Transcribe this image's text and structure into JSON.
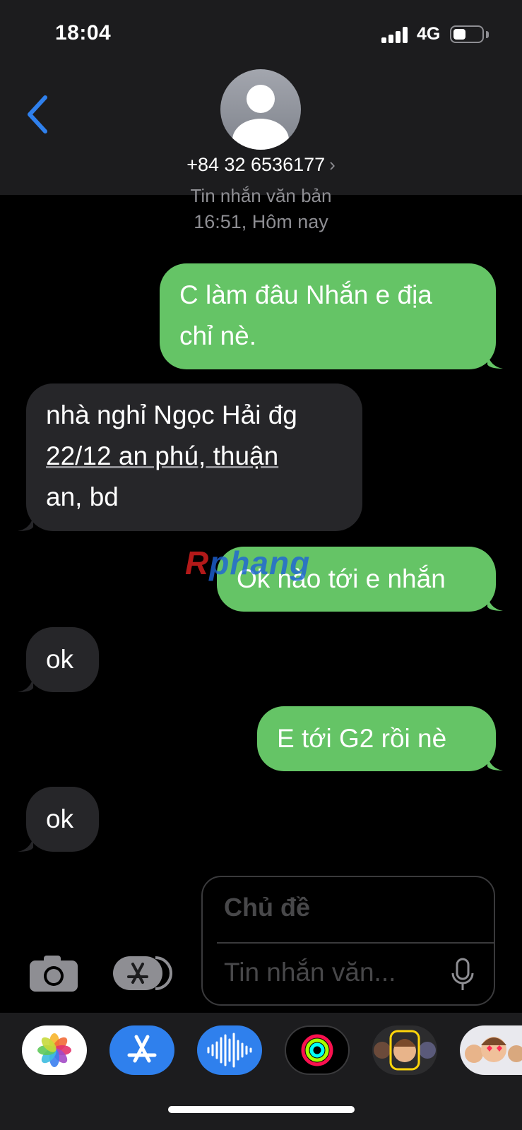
{
  "status_bar": {
    "time": "18:04",
    "network": "4G",
    "battery_level": 0.45
  },
  "header": {
    "contact": "+84 32 6536177"
  },
  "thread": {
    "service": "Tin nhắn văn bản",
    "timestamp": "16:51, Hôm nay",
    "messages": [
      {
        "from": "me",
        "lines": [
          "C làm đâu Nhắn e địa",
          "chỉ nè."
        ]
      },
      {
        "from": "them",
        "lines": [
          "nhà nghỉ Ngọc Hải đg",
          "22/12 an phú, thuận",
          "an, bd"
        ]
      },
      {
        "from": "me",
        "lines": [
          "Ok nào tới e nhắn"
        ]
      },
      {
        "from": "them",
        "lines": [
          "ok"
        ]
      },
      {
        "from": "me",
        "lines": [
          "E tới G2 rồi nè"
        ]
      },
      {
        "from": "them",
        "lines": [
          "ok"
        ]
      }
    ]
  },
  "watermark": {
    "first_letter": "R",
    "rest": "phang"
  },
  "composer": {
    "subject_placeholder": "Chủ đề",
    "message_placeholder": "Tin nhắn văn..."
  },
  "icons": {
    "back": "chevron-left-icon",
    "camera": "camera-icon",
    "app_store": "app-store-icon",
    "mic": "microphone-icon"
  },
  "app_strip": [
    "photos",
    "app-store",
    "audio-message",
    "activity",
    "memoji",
    "memoji-stickers"
  ],
  "colors": {
    "outgoing": "#65c466",
    "incoming": "#262629",
    "accent": "#2f80ed"
  }
}
